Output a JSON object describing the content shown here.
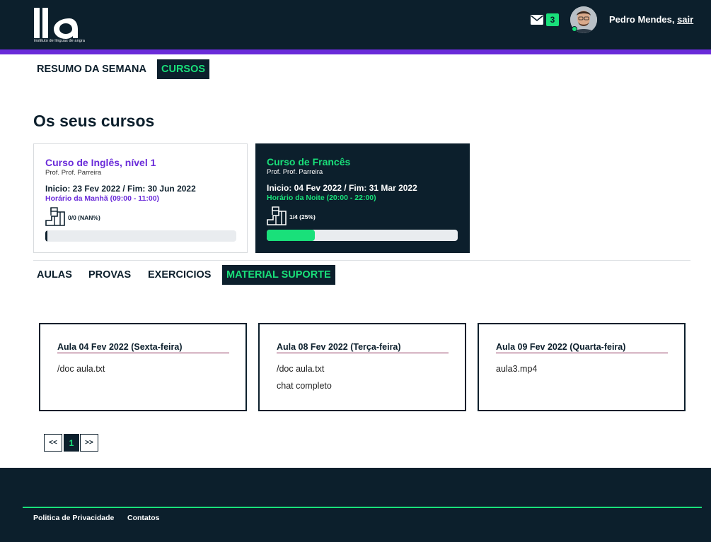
{
  "header": {
    "logo_text": "ila",
    "logo_tagline": "instituto de línguas de angra",
    "mail_count": "3",
    "user_name": "Pedro Mendes, ",
    "logout_label": "sair"
  },
  "nav": [
    {
      "label": "RESUMO DA SEMANA"
    },
    {
      "label": "CURSOS"
    }
  ],
  "page_title": "Os seus cursos",
  "courses": [
    {
      "title": "Curso de Inglês, nível 1",
      "prof": "Prof. Prof. Parreira",
      "dates": "Inicio: 23 Fev 2022 / Fim: 30 Jun 2022",
      "schedule": "Horário da Manhã (09:00 - 11:00)",
      "progress_text": "0/0 (NAN%)",
      "progress": 0
    },
    {
      "title": "Curso de Francês",
      "prof": "Prof. Prof. Parreira",
      "dates": "Inicio: 04 Fev 2022 / Fim: 31 Mar 2022",
      "schedule": "Horário da Noite (20:00 - 22:00)",
      "progress_text": "1/4 (25%)",
      "progress": 0.25
    }
  ],
  "subnav": [
    {
      "label": "AULAS"
    },
    {
      "label": "PROVAS"
    },
    {
      "label": "EXERCICIOS"
    },
    {
      "label": "MATERIAL SUPORTE"
    }
  ],
  "lessons": [
    {
      "title": "Aula 04 Fev 2022 (Sexta-feira)",
      "files": [
        "/doc aula.txt"
      ]
    },
    {
      "title": "Aula 08 Fev 2022 (Terça-feira)",
      "files": [
        "/doc aula.txt",
        "chat completo"
      ]
    },
    {
      "title": "Aula 09 Fev 2022 (Quarta-feira)",
      "files": [
        "aula3.mp4"
      ]
    }
  ],
  "pagination": {
    "prev": "<<",
    "page": "1",
    "next": ">>"
  },
  "footer": {
    "privacy": "Politica de Privacidade",
    "contacts": "Contatos"
  },
  "colors": {
    "navy": "#0c1f2c",
    "accent_green": "#19e07a",
    "accent_purple": "#6a2bd9"
  }
}
